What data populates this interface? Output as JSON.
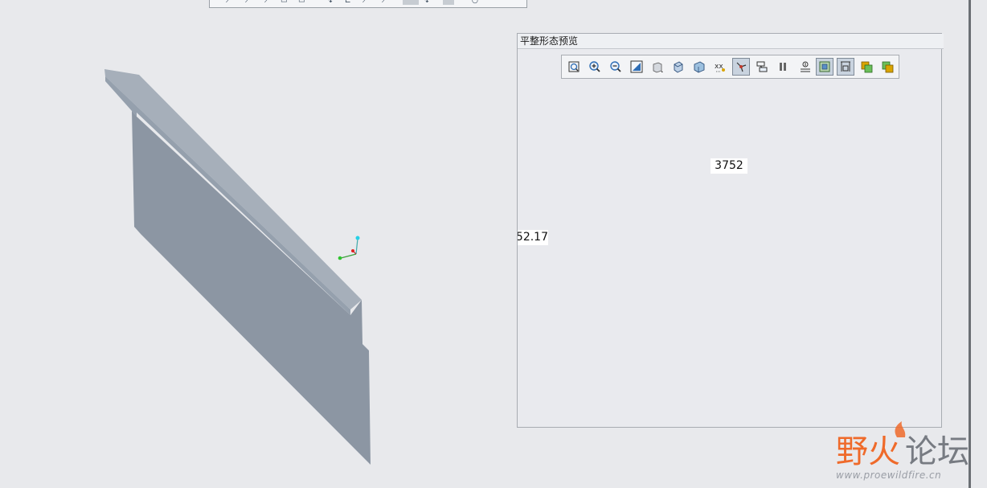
{
  "preview_panel": {
    "title": "平整形态预览",
    "toolbar": [
      {
        "icon": "zoom-fit-icon"
      },
      {
        "icon": "zoom-in-icon"
      },
      {
        "icon": "zoom-out-icon"
      },
      {
        "icon": "refit-icon"
      },
      {
        "icon": "display-style-icon"
      },
      {
        "icon": "saved-orientation-icon"
      },
      {
        "icon": "named-view-icon"
      },
      {
        "icon": "datum-display-icon"
      },
      {
        "icon": "spin-center-icon",
        "active": true
      },
      {
        "icon": "annotation-display-icon"
      },
      {
        "icon": "pause-icon"
      },
      {
        "icon": "view-manager-icon"
      },
      {
        "icon": "flat-pattern-icon",
        "active": true
      },
      {
        "icon": "dimension-display-icon",
        "active": true
      },
      {
        "icon": "copy-view-icon"
      },
      {
        "icon": "paste-view-icon"
      }
    ],
    "dimensions": {
      "width": "3752",
      "height": "52.17"
    }
  },
  "watermark": {
    "logo_text": "野火论坛",
    "url": "www.proewildfire.cn"
  },
  "colors": {
    "background": "#e8e9ec",
    "part_face": "#8c96a3",
    "part_top": "#a6afba",
    "flat_fill": "#a3adbb",
    "dimension_line": "#3a2a66",
    "watermark_orange": "#ef6a2a",
    "watermark_gray": "#777b82"
  }
}
